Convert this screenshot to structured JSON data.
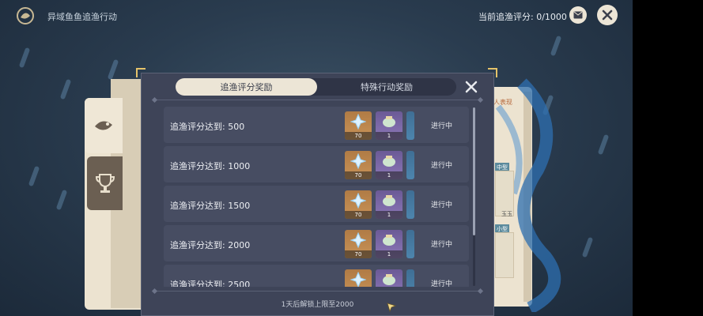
{
  "header": {
    "event_title": "异域鱼鱼追渔行动",
    "score_text": "当前追渔评分: 0/1000"
  },
  "tabs": {
    "score_rewards": "追渔评分奖励",
    "special_rewards": "特殊行动奖励"
  },
  "reward_rows": [
    {
      "label": "追渔评分达到: 500",
      "primogem_count": "70",
      "item_count": "1",
      "status": "进行中"
    },
    {
      "label": "追渔评分达到: 1000",
      "primogem_count": "70",
      "item_count": "1",
      "status": "进行中"
    },
    {
      "label": "追渔评分达到: 1500",
      "primogem_count": "70",
      "item_count": "1",
      "status": "进行中"
    },
    {
      "label": "追渔评分达到: 2000",
      "primogem_count": "70",
      "item_count": "1",
      "status": "进行中"
    },
    {
      "label": "追渔评分达到: 2500",
      "primogem_count": "",
      "item_count": "",
      "status": "进行中"
    }
  ],
  "footer": {
    "unlock_text": "1天后解锁上限至2000"
  },
  "right_panel": {
    "label": "人表现",
    "tag_medium": "中型",
    "tag_small": "小型",
    "small_text": "玉玉"
  },
  "colors": {
    "modal_bg": "#3e4458",
    "row_bg": "#474d62",
    "active_tab": "#ece5d6",
    "accent_gold": "#e5c36a"
  }
}
